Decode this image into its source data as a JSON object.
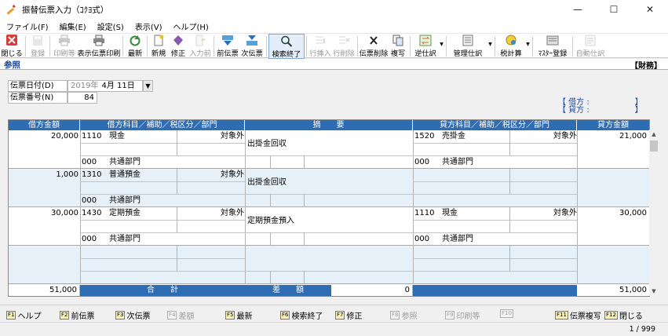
{
  "window": {
    "title": "振替伝票入力（ｺｸﾖ式）",
    "icon": "edit-pen-icon",
    "minimize": "—",
    "maximize": "☐",
    "close": "✕"
  },
  "menu": [
    "ファイル(F)",
    "編集(E)",
    "設定(S)",
    "表示(V)",
    "ヘルプ(H)"
  ],
  "toolbar": [
    {
      "label": "閉じる",
      "icon": "close-x-icon",
      "enabled": true
    },
    {
      "label": "登録",
      "icon": "register-disk-icon",
      "enabled": false
    },
    {
      "label": "印刷等",
      "icon": "printer-icon",
      "enabled": false
    },
    {
      "label": "表示伝票印刷",
      "icon": "printer-icon",
      "enabled": true
    },
    {
      "label": "最新",
      "icon": "refresh-icon",
      "enabled": true
    },
    {
      "label": "新規",
      "icon": "new-document-icon",
      "enabled": true
    },
    {
      "label": "修正",
      "icon": "eraser-icon",
      "enabled": true
    },
    {
      "label": "入力前",
      "icon": "undo-document-icon",
      "enabled": false
    },
    {
      "label": "前伝票",
      "icon": "previous-slip-icon",
      "enabled": true
    },
    {
      "label": "次伝票",
      "icon": "next-slip-icon",
      "enabled": true
    },
    {
      "label": "検索終了",
      "icon": "search-icon",
      "enabled": true,
      "selected": true
    },
    {
      "label": "行挿入",
      "icon": "insert-row-icon",
      "enabled": false
    },
    {
      "label": "行削除",
      "icon": "delete-row-icon",
      "enabled": false
    },
    {
      "label": "伝票削除",
      "icon": "delete-slip-icon",
      "enabled": true
    },
    {
      "label": "複写",
      "icon": "copy-icon",
      "enabled": true
    },
    {
      "label": "逆仕訳",
      "icon": "reverse-entry-icon",
      "enabled": true,
      "dropdown": true
    },
    {
      "label": "管理仕訳",
      "icon": "managed-entry-icon",
      "enabled": true,
      "dropdown": true
    },
    {
      "label": "税計算",
      "icon": "tax-calc-icon",
      "enabled": true,
      "dropdown": true
    },
    {
      "label": "ﾏｽﾀｰ登録",
      "icon": "master-register-icon",
      "enabled": true
    },
    {
      "label": "自動仕訳",
      "icon": "auto-entry-icon",
      "enabled": false
    }
  ],
  "mode_label": "参照",
  "category_label": "【財務】",
  "form": {
    "date_label": "伝票日付(D)",
    "date_era": "2019年",
    "date_month_day": "4月 11日",
    "number_label": "伝票番号(N)",
    "number_value": "84"
  },
  "taishaku": {
    "debit_open": "【 借方 :",
    "credit_open": "【 貸方 :",
    "close": "】"
  },
  "grid": {
    "headers": [
      "借方金額",
      "借方科目／補助／税区分／部門",
      "摘　　要",
      "貸方科目／補助／税区分／部門",
      "貸方金額"
    ],
    "rows": [
      {
        "debit_amount": "20,000",
        "debit_code": "1110",
        "debit_name": "現金",
        "debit_tax": "対象外",
        "debit_dept_code": "000",
        "debit_dept_name": "共通部門",
        "memo": "出掛金回収",
        "credit_code": "1520",
        "credit_name": "売掛金",
        "credit_tax": "対象外",
        "credit_dept_code": "000",
        "credit_dept_name": "共通部門",
        "credit_amount": "21,000"
      },
      {
        "debit_amount": "1,000",
        "debit_code": "1310",
        "debit_name": "普通預金",
        "debit_tax": "対象外",
        "debit_dept_code": "000",
        "debit_dept_name": "共通部門",
        "memo": "出掛金回収",
        "credit_code": "",
        "credit_name": "",
        "credit_tax": "",
        "credit_dept_code": "",
        "credit_dept_name": "",
        "credit_amount": ""
      },
      {
        "debit_amount": "30,000",
        "debit_code": "1430",
        "debit_name": "定期預金",
        "debit_tax": "対象外",
        "debit_dept_code": "000",
        "debit_dept_name": "共通部門",
        "memo": "定期預金預入",
        "credit_code": "1110",
        "credit_name": "現金",
        "credit_tax": "対象外",
        "credit_dept_code": "000",
        "credit_dept_name": "共通部門",
        "credit_amount": "30,000"
      },
      {
        "debit_amount": "",
        "debit_code": "",
        "debit_name": "",
        "debit_tax": "",
        "debit_dept_code": "",
        "debit_dept_name": "",
        "memo": "",
        "credit_code": "",
        "credit_name": "",
        "credit_tax": "",
        "credit_dept_code": "",
        "credit_dept_name": "",
        "credit_amount": ""
      }
    ],
    "total_debit": "51,000",
    "total_label": "合　　計",
    "diff_label": "差　　額",
    "diff_value": "0",
    "total_credit": "51,000"
  },
  "fkeys": [
    {
      "key": "F1",
      "label": "ヘルプ",
      "enabled": true
    },
    {
      "key": "F2",
      "label": "前伝票",
      "enabled": true
    },
    {
      "key": "F3",
      "label": "次伝票",
      "enabled": true
    },
    {
      "key": "F4",
      "label": "差額",
      "enabled": false
    },
    {
      "key": "F5",
      "label": "最新",
      "enabled": true
    },
    {
      "key": "F6",
      "label": "検索終了",
      "enabled": true
    },
    {
      "key": "F7",
      "label": "修正",
      "enabled": true
    },
    {
      "key": "F8",
      "label": "参照",
      "enabled": false
    },
    {
      "key": "F9",
      "label": "印刷等",
      "enabled": false
    },
    {
      "key": "F10",
      "label": "",
      "enabled": false
    },
    {
      "key": "F11",
      "label": "伝票複写",
      "enabled": true
    },
    {
      "key": "F12",
      "label": "閉じる",
      "enabled": true
    }
  ],
  "status": {
    "page": "1 / 999"
  }
}
